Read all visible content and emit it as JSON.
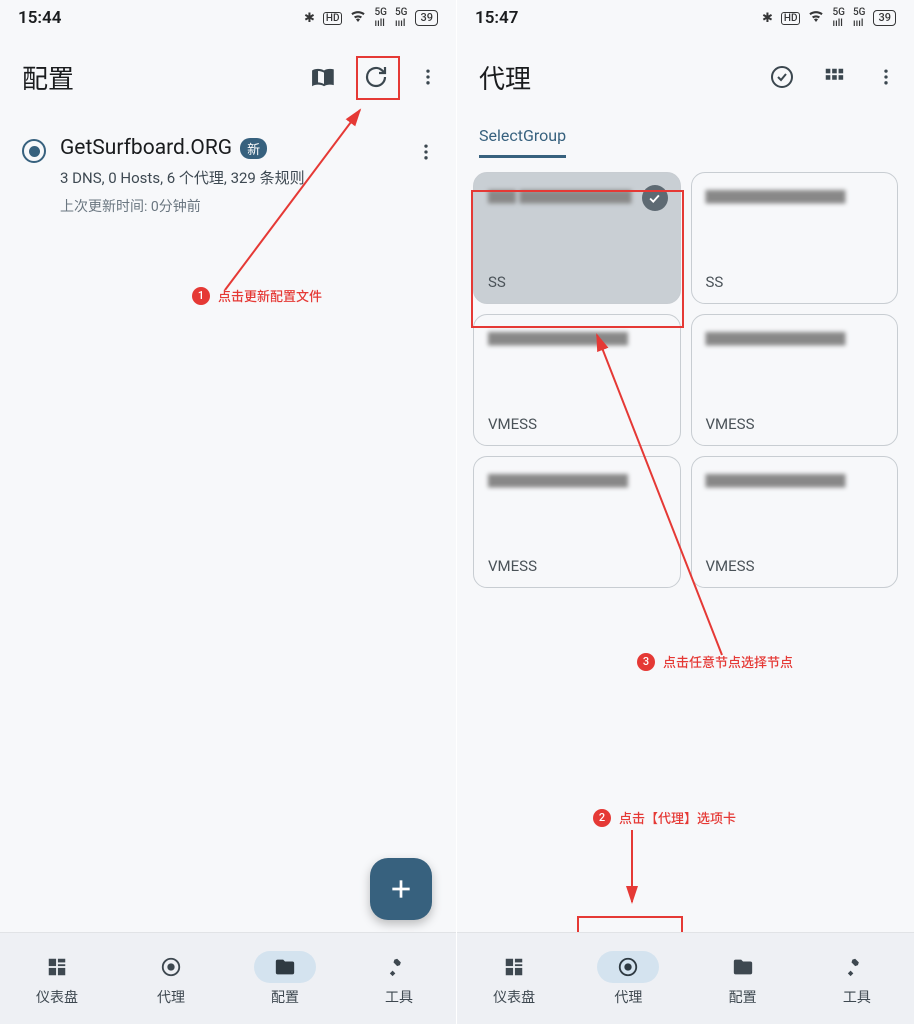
{
  "left": {
    "time": "15:44",
    "battery": "39",
    "appbar_title": "配置",
    "config": {
      "title": "GetSurfboard.ORG",
      "badge": "新",
      "summary": "3 DNS, 0 Hosts, 6 个代理, 329 条规则",
      "updated": "上次更新时间: 0分钟前"
    },
    "annotation1": "点击更新配置文件",
    "nav": [
      "仪表盘",
      "代理",
      "配置",
      "工具"
    ]
  },
  "right": {
    "time": "15:47",
    "battery": "39",
    "appbar_title": "代理",
    "tab": "SelectGroup",
    "nodes": [
      {
        "name": "██ ████████",
        "proto": "SS",
        "selected": true
      },
      {
        "name": "██████████",
        "proto": "SS"
      },
      {
        "name": "██████████",
        "proto": "VMESS"
      },
      {
        "name": "██████████",
        "proto": "VMESS"
      },
      {
        "name": "██████████",
        "proto": "VMESS"
      },
      {
        "name": "██████████",
        "proto": "VMESS"
      }
    ],
    "annotation2": "点击【代理】选项卡",
    "annotation3": "点击任意节点选择节点",
    "nav": [
      "仪表盘",
      "代理",
      "配置",
      "工具"
    ]
  }
}
